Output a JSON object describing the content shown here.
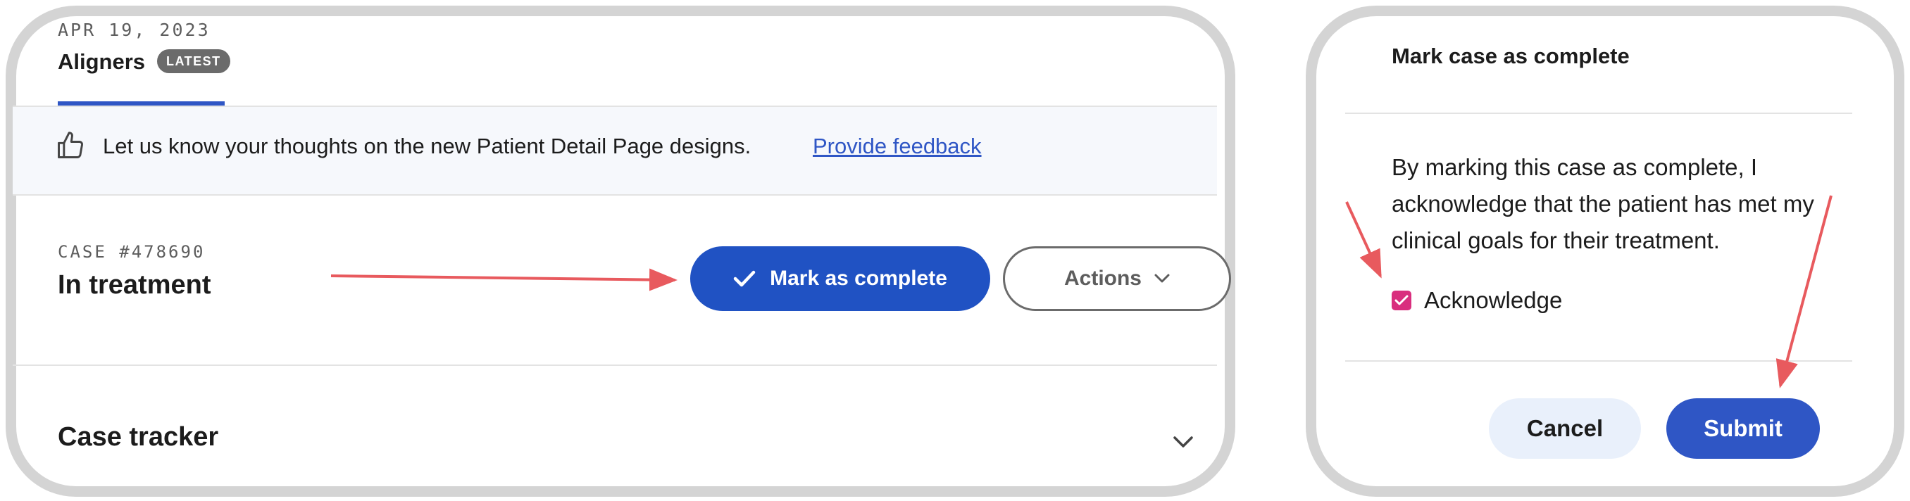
{
  "left_panel": {
    "date": "APR 19, 2023",
    "tab_title": "Aligners",
    "badge": "LATEST",
    "banner": {
      "icon": "thumbs-up-icon",
      "text": "Let us know your thoughts on the new Patient Detail Page designs.",
      "link": "Provide feedback"
    },
    "case": {
      "number": "CASE #478690",
      "status": "In treatment"
    },
    "mark_complete_label": "Mark as complete",
    "actions_label": "Actions",
    "case_tracker_label": "Case tracker"
  },
  "modal": {
    "title": "Mark case as complete",
    "body": "By marking this case as complete, I acknowledge that the patient has met my clinical goals for their treatment.",
    "checkbox_label": "Acknowledge",
    "checkbox_checked": true,
    "cancel_label": "Cancel",
    "submit_label": "Submit"
  },
  "colors": {
    "primary": "#2052c3",
    "checkbox": "#d92e7e",
    "annotation_arrow": "#e85a5e"
  }
}
